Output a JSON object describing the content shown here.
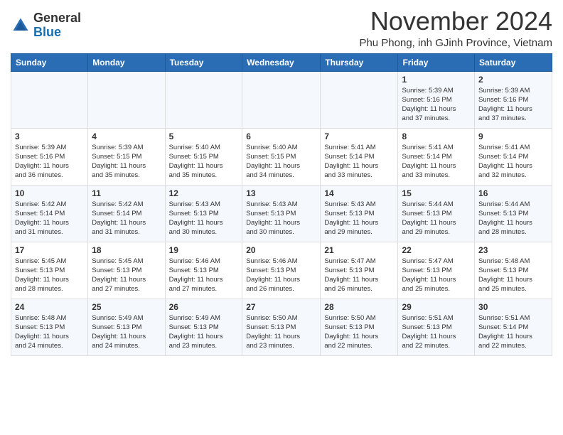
{
  "logo": {
    "general": "General",
    "blue": "Blue"
  },
  "title": "November 2024",
  "location": "Phu Phong, inh GJinh Province, Vietnam",
  "headers": [
    "Sunday",
    "Monday",
    "Tuesday",
    "Wednesday",
    "Thursday",
    "Friday",
    "Saturday"
  ],
  "weeks": [
    [
      {
        "day": "",
        "info": ""
      },
      {
        "day": "",
        "info": ""
      },
      {
        "day": "",
        "info": ""
      },
      {
        "day": "",
        "info": ""
      },
      {
        "day": "",
        "info": ""
      },
      {
        "day": "1",
        "info": "Sunrise: 5:39 AM\nSunset: 5:16 PM\nDaylight: 11 hours\nand 37 minutes."
      },
      {
        "day": "2",
        "info": "Sunrise: 5:39 AM\nSunset: 5:16 PM\nDaylight: 11 hours\nand 37 minutes."
      }
    ],
    [
      {
        "day": "3",
        "info": "Sunrise: 5:39 AM\nSunset: 5:16 PM\nDaylight: 11 hours\nand 36 minutes."
      },
      {
        "day": "4",
        "info": "Sunrise: 5:39 AM\nSunset: 5:15 PM\nDaylight: 11 hours\nand 35 minutes."
      },
      {
        "day": "5",
        "info": "Sunrise: 5:40 AM\nSunset: 5:15 PM\nDaylight: 11 hours\nand 35 minutes."
      },
      {
        "day": "6",
        "info": "Sunrise: 5:40 AM\nSunset: 5:15 PM\nDaylight: 11 hours\nand 34 minutes."
      },
      {
        "day": "7",
        "info": "Sunrise: 5:41 AM\nSunset: 5:14 PM\nDaylight: 11 hours\nand 33 minutes."
      },
      {
        "day": "8",
        "info": "Sunrise: 5:41 AM\nSunset: 5:14 PM\nDaylight: 11 hours\nand 33 minutes."
      },
      {
        "day": "9",
        "info": "Sunrise: 5:41 AM\nSunset: 5:14 PM\nDaylight: 11 hours\nand 32 minutes."
      }
    ],
    [
      {
        "day": "10",
        "info": "Sunrise: 5:42 AM\nSunset: 5:14 PM\nDaylight: 11 hours\nand 31 minutes."
      },
      {
        "day": "11",
        "info": "Sunrise: 5:42 AM\nSunset: 5:14 PM\nDaylight: 11 hours\nand 31 minutes."
      },
      {
        "day": "12",
        "info": "Sunrise: 5:43 AM\nSunset: 5:13 PM\nDaylight: 11 hours\nand 30 minutes."
      },
      {
        "day": "13",
        "info": "Sunrise: 5:43 AM\nSunset: 5:13 PM\nDaylight: 11 hours\nand 30 minutes."
      },
      {
        "day": "14",
        "info": "Sunrise: 5:43 AM\nSunset: 5:13 PM\nDaylight: 11 hours\nand 29 minutes."
      },
      {
        "day": "15",
        "info": "Sunrise: 5:44 AM\nSunset: 5:13 PM\nDaylight: 11 hours\nand 29 minutes."
      },
      {
        "day": "16",
        "info": "Sunrise: 5:44 AM\nSunset: 5:13 PM\nDaylight: 11 hours\nand 28 minutes."
      }
    ],
    [
      {
        "day": "17",
        "info": "Sunrise: 5:45 AM\nSunset: 5:13 PM\nDaylight: 11 hours\nand 28 minutes."
      },
      {
        "day": "18",
        "info": "Sunrise: 5:45 AM\nSunset: 5:13 PM\nDaylight: 11 hours\nand 27 minutes."
      },
      {
        "day": "19",
        "info": "Sunrise: 5:46 AM\nSunset: 5:13 PM\nDaylight: 11 hours\nand 27 minutes."
      },
      {
        "day": "20",
        "info": "Sunrise: 5:46 AM\nSunset: 5:13 PM\nDaylight: 11 hours\nand 26 minutes."
      },
      {
        "day": "21",
        "info": "Sunrise: 5:47 AM\nSunset: 5:13 PM\nDaylight: 11 hours\nand 26 minutes."
      },
      {
        "day": "22",
        "info": "Sunrise: 5:47 AM\nSunset: 5:13 PM\nDaylight: 11 hours\nand 25 minutes."
      },
      {
        "day": "23",
        "info": "Sunrise: 5:48 AM\nSunset: 5:13 PM\nDaylight: 11 hours\nand 25 minutes."
      }
    ],
    [
      {
        "day": "24",
        "info": "Sunrise: 5:48 AM\nSunset: 5:13 PM\nDaylight: 11 hours\nand 24 minutes."
      },
      {
        "day": "25",
        "info": "Sunrise: 5:49 AM\nSunset: 5:13 PM\nDaylight: 11 hours\nand 24 minutes."
      },
      {
        "day": "26",
        "info": "Sunrise: 5:49 AM\nSunset: 5:13 PM\nDaylight: 11 hours\nand 23 minutes."
      },
      {
        "day": "27",
        "info": "Sunrise: 5:50 AM\nSunset: 5:13 PM\nDaylight: 11 hours\nand 23 minutes."
      },
      {
        "day": "28",
        "info": "Sunrise: 5:50 AM\nSunset: 5:13 PM\nDaylight: 11 hours\nand 22 minutes."
      },
      {
        "day": "29",
        "info": "Sunrise: 5:51 AM\nSunset: 5:13 PM\nDaylight: 11 hours\nand 22 minutes."
      },
      {
        "day": "30",
        "info": "Sunrise: 5:51 AM\nSunset: 5:14 PM\nDaylight: 11 hours\nand 22 minutes."
      }
    ]
  ]
}
